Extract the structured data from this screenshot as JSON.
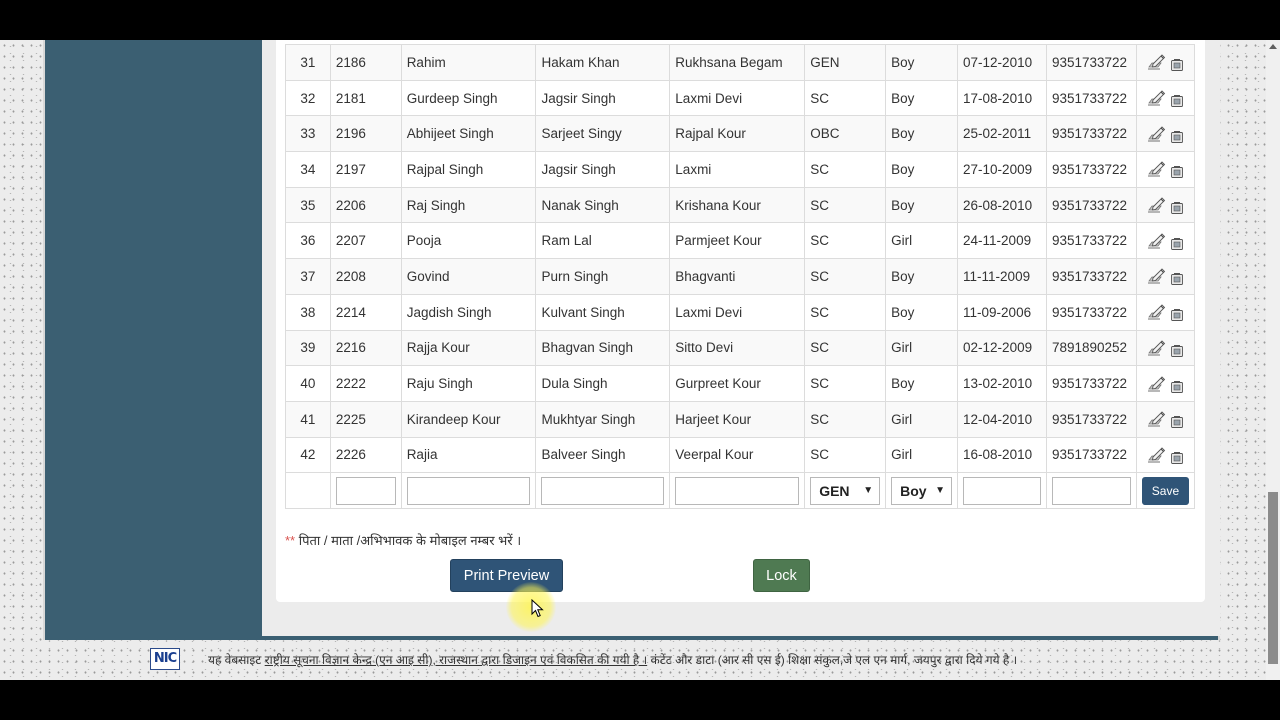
{
  "table": {
    "rows": [
      {
        "sn": "31",
        "id": "2186",
        "name": "Rahim",
        "father": "Hakam Khan",
        "mother": "Rukhsana Begam",
        "category": "GEN",
        "gender": "Boy",
        "dob": "07-12-2010",
        "mobile": "9351733722"
      },
      {
        "sn": "32",
        "id": "2181",
        "name": "Gurdeep Singh",
        "father": "Jagsir Singh",
        "mother": "Laxmi Devi",
        "category": "SC",
        "gender": "Boy",
        "dob": "17-08-2010",
        "mobile": "9351733722"
      },
      {
        "sn": "33",
        "id": "2196",
        "name": "Abhijeet Singh",
        "father": "Sarjeet Singy",
        "mother": "Rajpal Kour",
        "category": "OBC",
        "gender": "Boy",
        "dob": "25-02-2011",
        "mobile": "9351733722"
      },
      {
        "sn": "34",
        "id": "2197",
        "name": "Rajpal Singh",
        "father": "Jagsir Singh",
        "mother": "Laxmi",
        "category": "SC",
        "gender": "Boy",
        "dob": "27-10-2009",
        "mobile": "9351733722"
      },
      {
        "sn": "35",
        "id": "2206",
        "name": "Raj Singh",
        "father": "Nanak Singh",
        "mother": "Krishana Kour",
        "category": "SC",
        "gender": "Boy",
        "dob": "26-08-2010",
        "mobile": "9351733722"
      },
      {
        "sn": "36",
        "id": "2207",
        "name": "Pooja",
        "father": "Ram Lal",
        "mother": "Parmjeet Kour",
        "category": "SC",
        "gender": "Girl",
        "dob": "24-11-2009",
        "mobile": "9351733722"
      },
      {
        "sn": "37",
        "id": "2208",
        "name": "Govind",
        "father": "Purn Singh",
        "mother": "Bhagvanti",
        "category": "SC",
        "gender": "Boy",
        "dob": "11-11-2009",
        "mobile": "9351733722"
      },
      {
        "sn": "38",
        "id": "2214",
        "name": "Jagdish Singh",
        "father": "Kulvant Singh",
        "mother": "Laxmi Devi",
        "category": "SC",
        "gender": "Boy",
        "dob": "11-09-2006",
        "mobile": "9351733722"
      },
      {
        "sn": "39",
        "id": "2216",
        "name": "Rajja Kour",
        "father": "Bhagvan Singh",
        "mother": "Sitto Devi",
        "category": "SC",
        "gender": "Girl",
        "dob": "02-12-2009",
        "mobile": "7891890252"
      },
      {
        "sn": "40",
        "id": "2222",
        "name": "Raju Singh",
        "father": "Dula Singh",
        "mother": "Gurpreet Kour",
        "category": "SC",
        "gender": "Boy",
        "dob": "13-02-2010",
        "mobile": "9351733722"
      },
      {
        "sn": "41",
        "id": "2225",
        "name": "Kirandeep Kour",
        "father": "Mukhtyar Singh",
        "mother": "Harjeet Kour",
        "category": "SC",
        "gender": "Girl",
        "dob": "12-04-2010",
        "mobile": "9351733722"
      },
      {
        "sn": "42",
        "id": "2226",
        "name": "Rajia",
        "father": "Balveer Singh",
        "mother": "Veerpal Kour",
        "category": "SC",
        "gender": "Girl",
        "dob": "16-08-2010",
        "mobile": "9351733722"
      }
    ],
    "new_row": {
      "category_selected": "GEN",
      "gender_selected": "Boy",
      "save_label": "Save"
    }
  },
  "note": {
    "stars": "**",
    "text": " पिता / माता /अभिभावक के मोबाइल नम्बर भरें ।"
  },
  "buttons": {
    "print_preview": "Print Preview",
    "lock": "Lock"
  },
  "footer": {
    "logo_text": "NIC",
    "prefix": "यह वेबसाइट ",
    "link_text": "राष्ट्रीय सूचना विज्ञान केन्द्र (एन आइ सी), राजस्थान द्वारा डिजाइन एवं विकसित की गयी है ।",
    "suffix": " कंटेंट और डाटा (आर सी एस ई) शिक्षा संकुल,जे एल एन मार्ग, जयपुर द्वारा दिये गये है ।"
  },
  "icons": {
    "edit": "edit-pencil-icon",
    "delete": "delete-icon"
  },
  "colors": {
    "primary_button": "#2f5477",
    "lock_button": "#4f7a52",
    "sidebar": "#3b5f72"
  }
}
